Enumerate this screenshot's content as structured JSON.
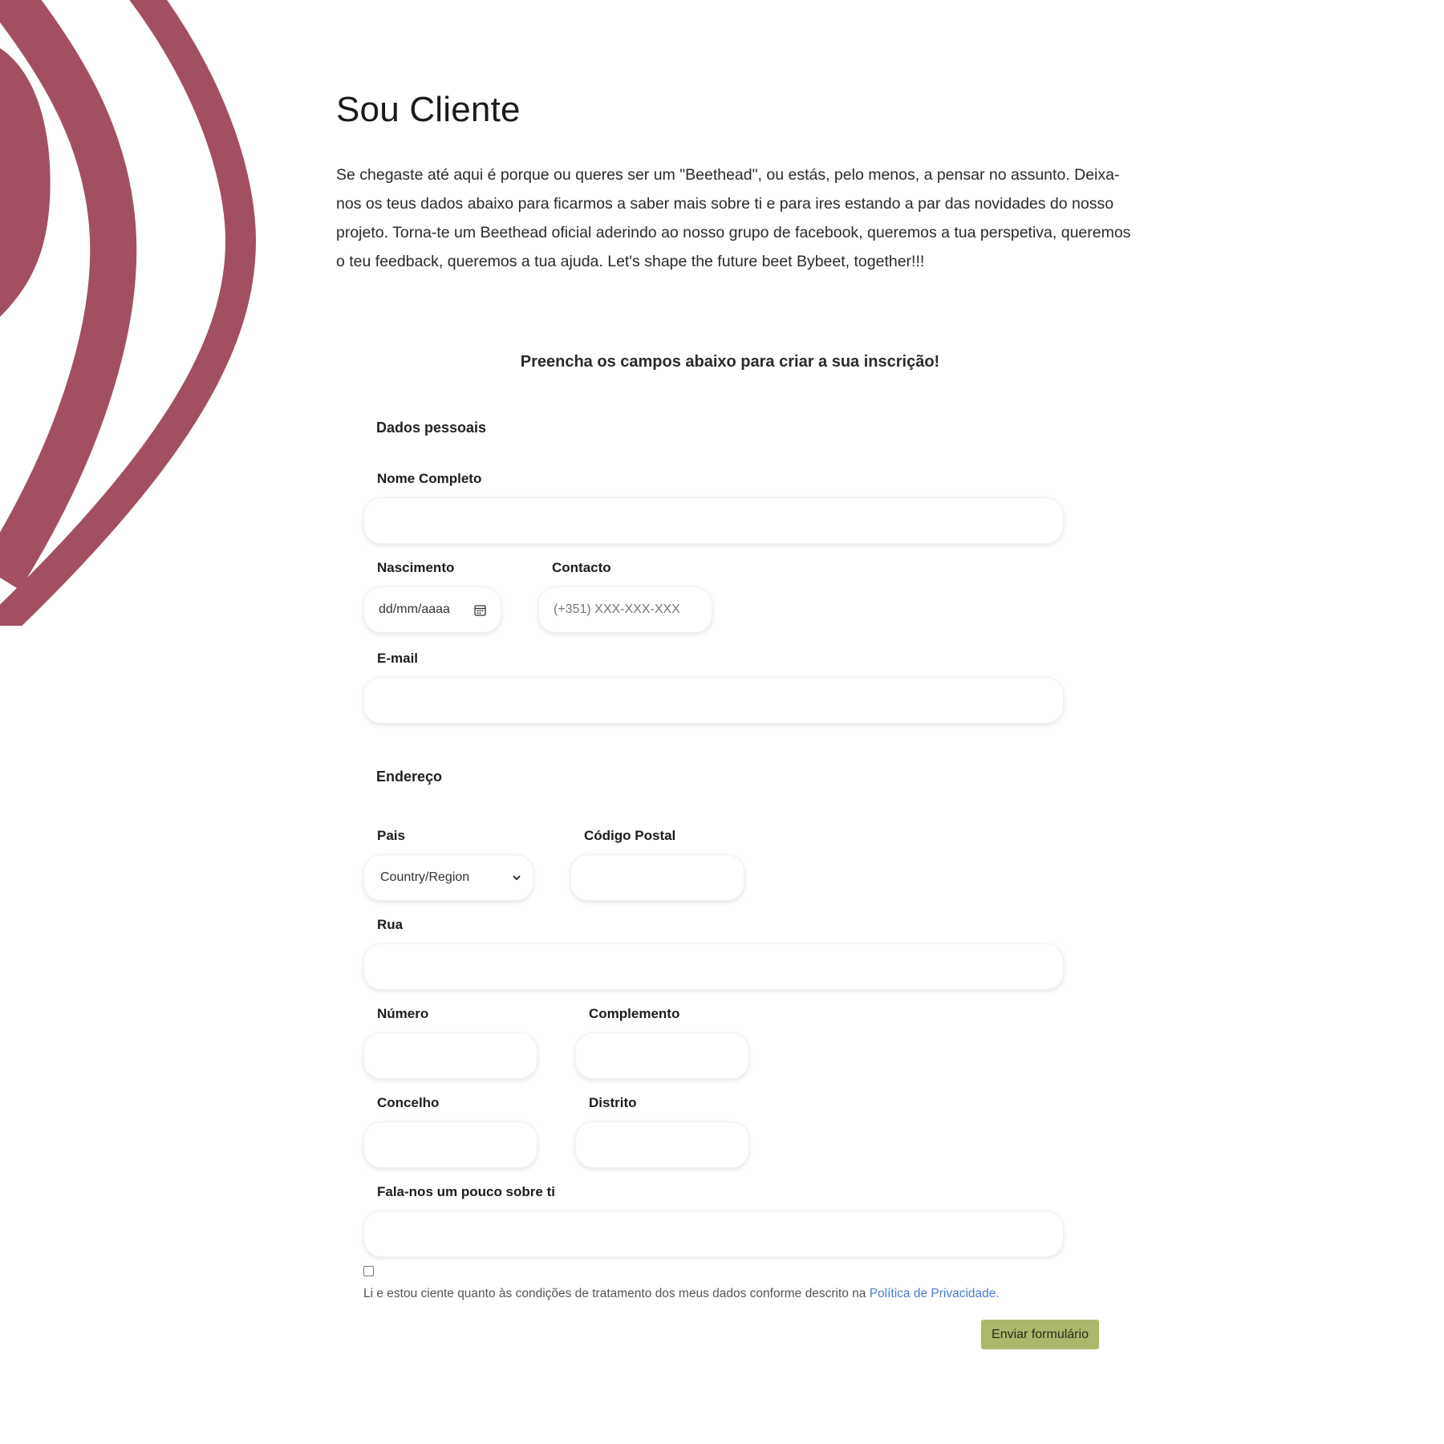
{
  "page": {
    "title": "Sou Cliente",
    "intro": "Se chegaste até aqui é porque ou queres ser um \"Beethead\", ou estás, pelo menos, a pensar no assunto. Deixa-nos os teus dados abaixo para ficarmos a saber mais sobre ti e para ires estando a par das novidades do nosso projeto. Torna-te um Beethead oficial aderindo ao nosso grupo de facebook, queremos a tua perspetiva, queremos o teu feedback, queremos a tua ajuda. Let's shape the future beet Bybeet, together!!!"
  },
  "form": {
    "title": "Preencha os campos abaixo para criar a sua inscrição!",
    "personal": {
      "section_title": "Dados pessoais",
      "name_label": "Nome Completo",
      "name_value": "",
      "birth_label": "Nascimento",
      "birth_placeholder": "dd/mm/aaaa",
      "contact_label": "Contacto",
      "contact_placeholder": "(+351) XXX-XXX-XXX",
      "email_label": "E-mail",
      "email_value": ""
    },
    "address": {
      "section_title": "Endereço",
      "country_label": "Pais",
      "country_selected": "Country/Region",
      "postal_label": "Código Postal",
      "street_label": "Rua",
      "number_label": "Número",
      "complement_label": "Complemento",
      "county_label": "Concelho",
      "district_label": "Distrito"
    },
    "about_label": "Fala-nos um pouco sobre ti",
    "consent_text": "Li e estou ciente quanto às condições de tratamento dos meus dados conforme descrito na ",
    "consent_link": "Política de Privacidade.",
    "submit_label": "Enviar formulário"
  },
  "colors": {
    "decor": "#a24f62",
    "submit": "#a9b86a",
    "link": "#4a7bd0"
  },
  "icons": {
    "date_picker": "calendar-icon",
    "select_arrow": "chevron-down-icon"
  }
}
